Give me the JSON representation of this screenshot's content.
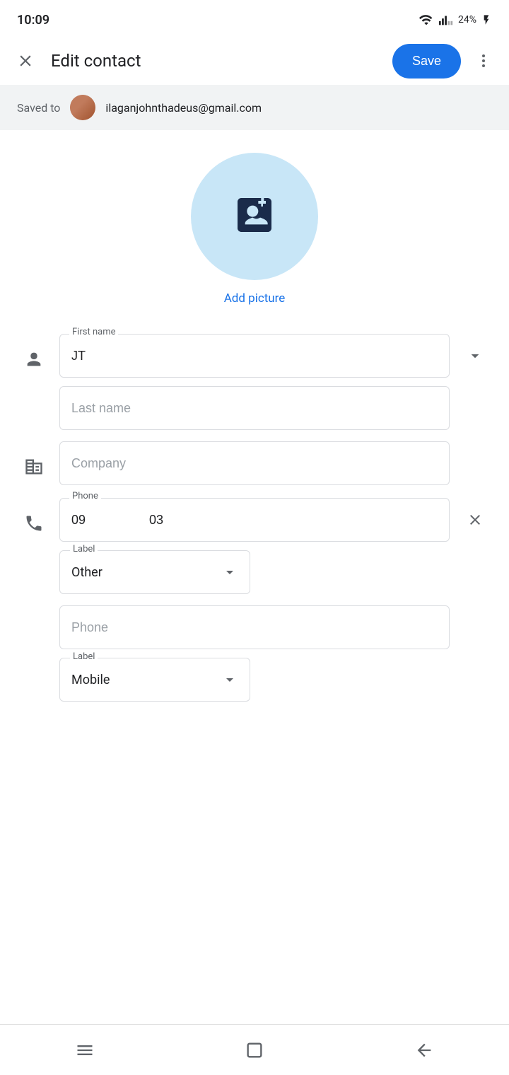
{
  "statusBar": {
    "time": "10:09",
    "battery": "24%",
    "batteryIcon": "battery-icon",
    "wifiIcon": "wifi-icon",
    "signalIcon": "signal-icon"
  },
  "toolbar": {
    "closeLabel": "✕",
    "title": "Edit contact",
    "saveLabel": "Save",
    "moreLabel": "⋮"
  },
  "savedTo": {
    "label": "Saved to",
    "email": "ilaganjohnthadeus@gmail.com"
  },
  "photo": {
    "addPictureLabel": "Add picture"
  },
  "form": {
    "firstNameLabel": "First name",
    "firstNameValue": "JT",
    "lastNamePlaceholder": "Last name",
    "companyPlaceholder": "Company",
    "phoneLabel": "Phone",
    "phoneValue": "09                  03",
    "label1Text": "Label",
    "label1Value": "Other",
    "phone2Placeholder": "Phone",
    "label2Text": "Label",
    "label2Value": "Mobile"
  },
  "bottomNav": {
    "menuIcon": "menu-icon",
    "homeIcon": "home-icon",
    "backIcon": "back-icon"
  }
}
